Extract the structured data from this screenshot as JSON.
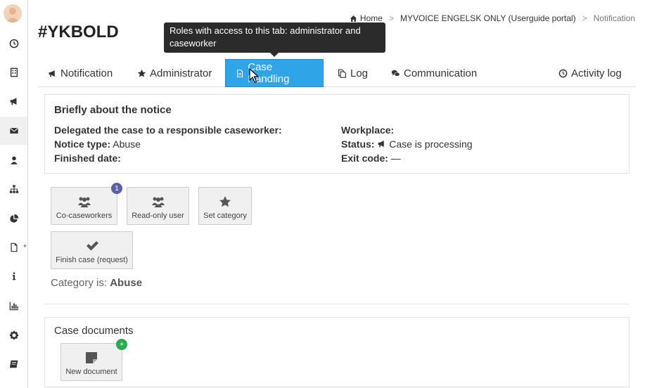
{
  "page": {
    "title": "#YKBOLD"
  },
  "breadcrumb": {
    "home": "Home",
    "portal": "MYVOICE ENGELSK ONLY (Userguide portal)",
    "current": "Notification"
  },
  "tooltip": {
    "text": "Roles with access to this tab: administrator and caseworker"
  },
  "tabs": [
    {
      "label": "Notification",
      "icon": "bullhorn-icon"
    },
    {
      "label": "Administrator",
      "icon": "star-icon"
    },
    {
      "label": "Case Handling",
      "icon": "file-icon",
      "active": true
    },
    {
      "label": "Log",
      "icon": "copy-icon"
    },
    {
      "label": "Communication",
      "icon": "comments-icon"
    },
    {
      "label": "Activity log",
      "icon": "clock-icon"
    }
  ],
  "summary": {
    "heading": "Briefly about the notice",
    "delegated_label": "Delegated the case to a responsible caseworker:",
    "delegated_value": "",
    "notice_type_label": "Notice type:",
    "notice_type_value": "Abuse",
    "finished_label": "Finished date:",
    "finished_value": "",
    "workplace_label": "Workplace:",
    "workplace_value": "",
    "status_label": "Status:",
    "status_value": "Case is processing",
    "exit_code_label": "Exit code:",
    "exit_code_value": "—"
  },
  "actions": {
    "co_caseworkers": {
      "label": "Co-caseworkers",
      "badge": "1"
    },
    "read_only_user": {
      "label": "Read-only user"
    },
    "set_category": {
      "label": "Set category"
    },
    "finish_case": {
      "label": "Finish case (request)"
    }
  },
  "category": {
    "prefix": "Category is:",
    "value": "Abuse"
  },
  "documents": {
    "heading": "Case documents",
    "new_document": {
      "label": "New document",
      "badge": "+"
    }
  },
  "colors": {
    "active_tab": "#2fa4e7",
    "tooltip_bg": "#2b2b2b",
    "badge_purple": "#5c5fa8",
    "badge_green": "#2aab52"
  },
  "sidebar": {
    "items": [
      "avatar",
      "dashboard-icon",
      "building-icon",
      "bullhorn-icon",
      "envelope-icon",
      "user-icon",
      "sitemap-icon",
      "pie-chart-icon",
      "file-icon",
      "info-icon",
      "bar-chart-icon",
      "gear-icon",
      "book-icon"
    ]
  }
}
